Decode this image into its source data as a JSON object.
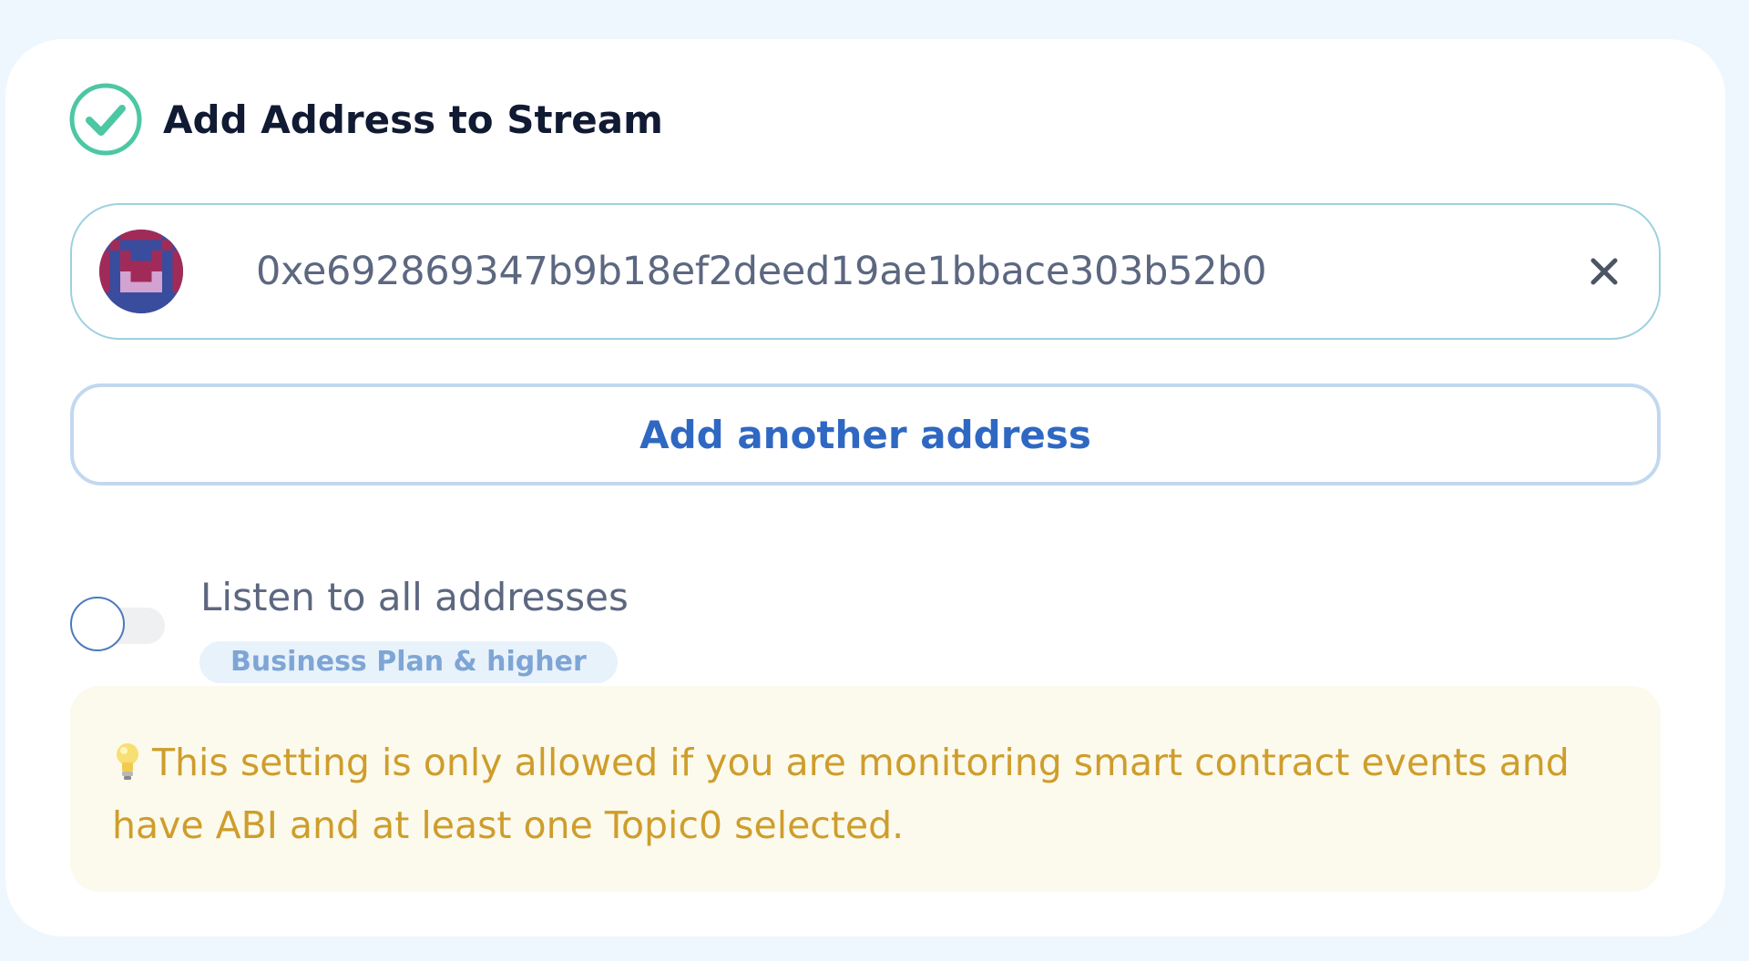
{
  "header": {
    "title": "Add Address to Stream",
    "status_icon": "check-circle-icon",
    "accent_color": "#4dc7a3"
  },
  "address_field": {
    "value": "0xe692869347b9b18ef2deed19ae1bbace303b52b0",
    "avatar_icon": "identicon-avatar",
    "clear_icon": "close-icon"
  },
  "actions": {
    "add_another_label": "Add another address"
  },
  "listen_all": {
    "label": "Listen to all addresses",
    "enabled": false,
    "badge": "Business Plan & higher"
  },
  "notice": {
    "icon": "lightbulb-icon",
    "text": "This setting is only allowed if you are monitoring smart contract events and have ABI and at least one Topic0 selected."
  },
  "colors": {
    "page_background": "#eef6fe",
    "card_background": "#ffffff",
    "primary_blue": "#2f68c2",
    "notice_text": "#ce9d2c",
    "notice_background": "#fcfaec"
  }
}
